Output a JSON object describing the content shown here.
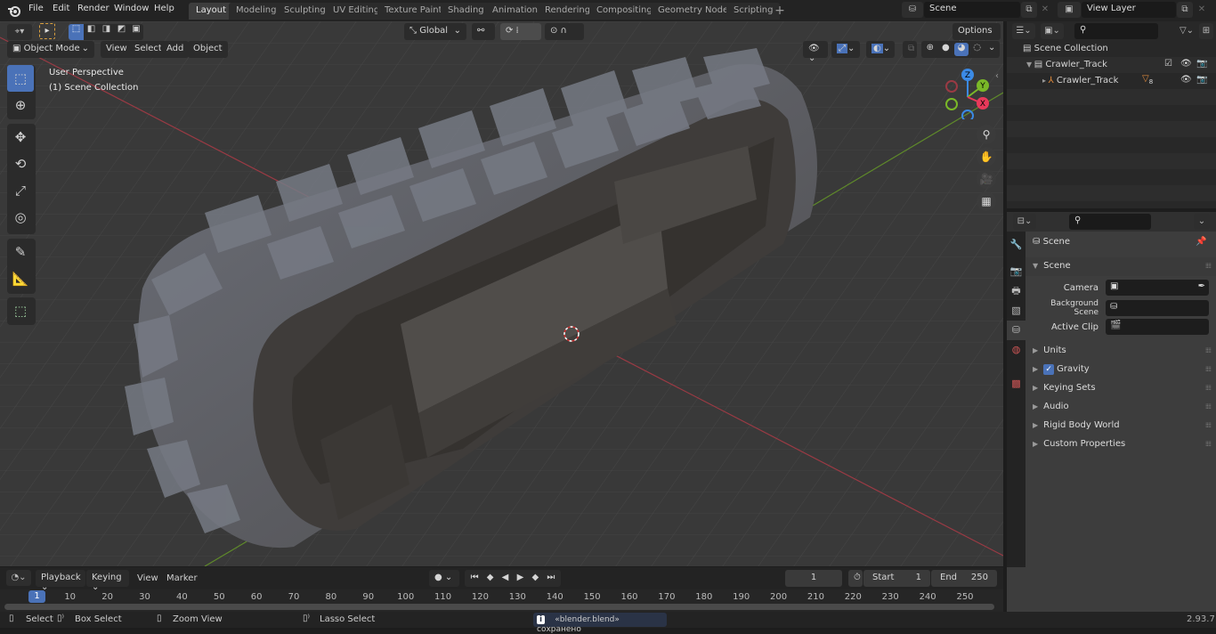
{
  "app": {
    "version": "2.93.7"
  },
  "menu": [
    "File",
    "Edit",
    "Render",
    "Window",
    "Help"
  ],
  "workspaces": [
    {
      "label": "Layout",
      "active": true
    },
    {
      "label": "Modeling"
    },
    {
      "label": "Sculpting"
    },
    {
      "label": "UV Editing"
    },
    {
      "label": "Texture Paint"
    },
    {
      "label": "Shading"
    },
    {
      "label": "Animation"
    },
    {
      "label": "Rendering"
    },
    {
      "label": "Compositing"
    },
    {
      "label": "Geometry Nodes"
    },
    {
      "label": "Scripting"
    }
  ],
  "add_workspace": "+",
  "scene_selector": {
    "value": "Scene"
  },
  "view_layer_selector": {
    "value": "View Layer"
  },
  "viewport": {
    "mode": "Object Mode",
    "menus": [
      "View",
      "Select",
      "Add",
      "Object"
    ],
    "transform_orientation": "Global",
    "options_label": "Options",
    "overlay_line1": "User Perspective",
    "overlay_line2": "(1) Scene Collection",
    "gizmo": {
      "x": "X",
      "y": "Y",
      "z": "Z",
      "x_color": "#e8395a",
      "y_color": "#7ab828",
      "z_color": "#3b8ae6"
    },
    "tools": [
      "select-box",
      "cursor",
      "move",
      "rotate",
      "scale",
      "transform",
      "annotate",
      "measure",
      "add-cube"
    ]
  },
  "outliner": {
    "root": "Scene Collection",
    "items": [
      {
        "name": "Crawler_Track",
        "type": "collection",
        "checked": true
      },
      {
        "name": "Crawler_Track",
        "type": "object",
        "modifier_count": "8"
      }
    ]
  },
  "properties": {
    "context_title": "Scene",
    "section_scene": "Scene",
    "fields": [
      {
        "label": "Camera",
        "value": ""
      },
      {
        "label": "Background Scene",
        "value": ""
      },
      {
        "label": "Active Clip",
        "value": ""
      }
    ],
    "panels": [
      {
        "label": "Units"
      },
      {
        "label": "Gravity",
        "checkbox": true
      },
      {
        "label": "Keying Sets"
      },
      {
        "label": "Audio"
      },
      {
        "label": "Rigid Body World"
      },
      {
        "label": "Custom Properties"
      }
    ]
  },
  "timeline": {
    "menus": [
      "Playback",
      "Keying",
      "View",
      "Marker"
    ],
    "current_frame": "1",
    "start_label": "Start",
    "start": "1",
    "end_label": "End",
    "end": "250",
    "ticks": [
      "1",
      "10",
      "20",
      "30",
      "40",
      "50",
      "60",
      "70",
      "80",
      "90",
      "100",
      "110",
      "120",
      "130",
      "140",
      "150",
      "160",
      "170",
      "180",
      "190",
      "200",
      "210",
      "220",
      "230",
      "240",
      "250"
    ]
  },
  "statusbar": {
    "select": "Select",
    "box_select": "Box Select",
    "zoom_view": "Zoom View",
    "lasso_select": "Lasso Select",
    "message": "«blender.blend» сохранено",
    "version": "2.93.7"
  }
}
